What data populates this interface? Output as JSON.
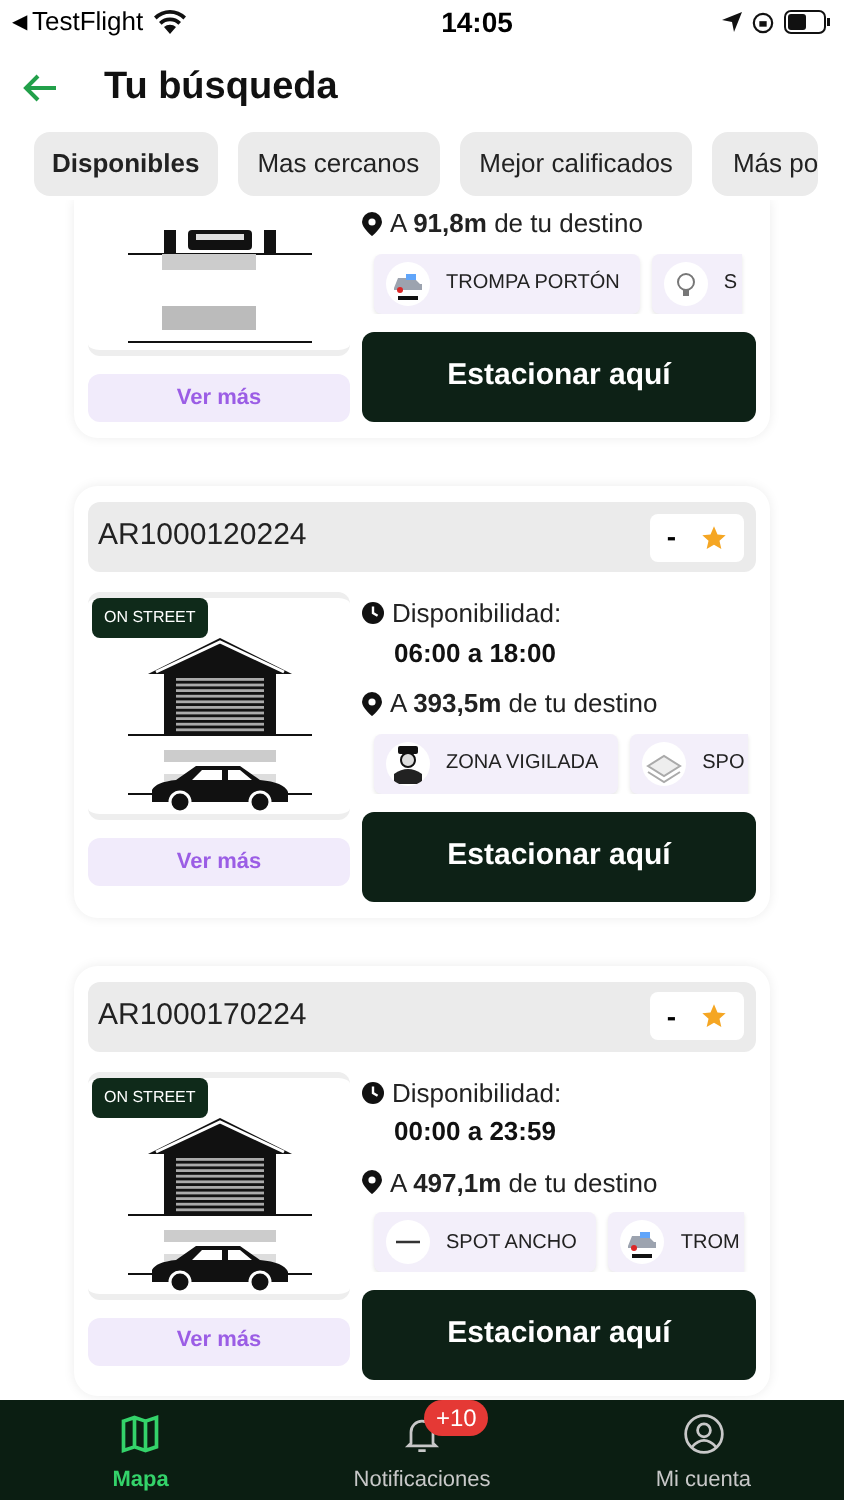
{
  "status_bar": {
    "back_glyph": "◀",
    "app": "TestFlight",
    "time": "14:05"
  },
  "header": {
    "title": "Tu búsqueda"
  },
  "filters": [
    {
      "label": "Disponibles",
      "selected": true
    },
    {
      "label": "Mas cercanos",
      "selected": false
    },
    {
      "label": "Mejor calificados",
      "selected": false
    },
    {
      "label": "Más po",
      "selected": false
    }
  ],
  "spots": [
    {
      "kind": "partial",
      "distance": "A **91,8m** de tu destino",
      "features": [
        {
          "kind": "car",
          "label": "TROMPA PORTÓN"
        },
        {
          "kind": "bulb",
          "label": "S"
        }
      ],
      "more": "Ver más",
      "action": "Estacionar aquí"
    },
    {
      "kind": "full",
      "code": "AR1000120224",
      "rating": "-",
      "badge": "ON STREET",
      "availability_label": "Disponibilidad:",
      "hours": "06:00 a 18:00",
      "distance": "A **393,5m** de tu destino",
      "features": [
        {
          "kind": "guard",
          "label": "ZONA VIGILADA"
        },
        {
          "kind": "stack",
          "label": "SPO"
        }
      ],
      "more": "Ver más",
      "action": "Estacionar aquí"
    },
    {
      "kind": "full",
      "code": "AR1000170224",
      "rating": "-",
      "badge": "ON STREET",
      "availability_label": "Disponibilidad:",
      "hours": "00:00 a 23:59",
      "distance": "A **497,1m** de tu destino",
      "features": [
        {
          "kind": "width",
          "label": "SPOT ANCHO"
        },
        {
          "kind": "car",
          "label": "TROM"
        }
      ],
      "more": "Ver más",
      "action": "Estacionar aquí"
    }
  ],
  "nav": [
    {
      "kind": "map",
      "label": "Mapa",
      "selected": true
    },
    {
      "kind": "bell",
      "label": "Notificaciones",
      "selected": false,
      "badge": "+10"
    },
    {
      "kind": "user",
      "label": "Mi cuenta",
      "selected": false
    }
  ]
}
